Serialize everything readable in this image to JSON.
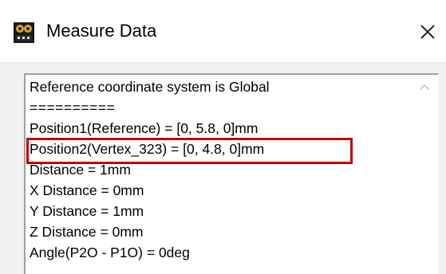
{
  "window": {
    "title": "Measure Data",
    "close_symbol": "✕"
  },
  "icons": {
    "app_icon": "edt-app-icon",
    "close_icon": "close-icon",
    "scroll_up_icon": "chevron-up-icon"
  },
  "colors": {
    "highlight_border": "#c00000",
    "window_bg": "#f0f0f0",
    "titlebar_bg": "#ffffff",
    "text": "#000000"
  },
  "measure_output": {
    "lines": [
      "Reference coordinate system is Global",
      "==========",
      "Position1(Reference) = [0, 5.8, 0]mm",
      "Position2(Vertex_323) = [0, 4.8, 0]mm",
      "Distance = 1mm",
      "X Distance = 0mm",
      "Y Distance = 1mm",
      "Z Distance = 0mm",
      "Angle(P2O - P1O) = 0deg"
    ],
    "highlighted_line_index": 3
  }
}
